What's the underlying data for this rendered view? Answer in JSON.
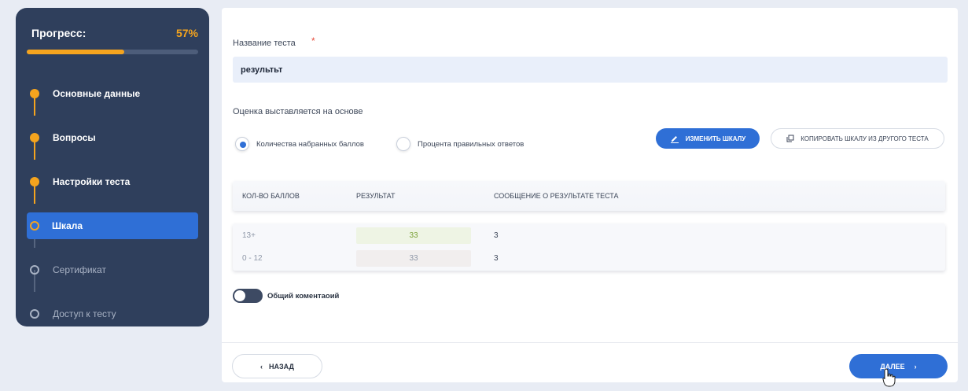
{
  "sidebar": {
    "progress_title": "Прогресс:",
    "progress_percent": "57%",
    "progress_value": 0.57,
    "steps": [
      {
        "label": "Основные данные",
        "state": "done"
      },
      {
        "label": "Вопросы",
        "state": "done"
      },
      {
        "label": "Настройки теста",
        "state": "done"
      },
      {
        "label": "Шкала",
        "state": "current"
      },
      {
        "label": "Сертификат",
        "state": "pending"
      },
      {
        "label": "Доступ к тесту",
        "state": "pending"
      }
    ]
  },
  "form": {
    "name_label": "Название теста",
    "required_mark": "*",
    "name_value": "результьт",
    "basis_label": "Оценка выставляется на основе",
    "radio_points": "Количества набранных баллов",
    "radio_percent": "Процента правильных ответов",
    "edit_scale_button": "Изменить шкалу",
    "copy_scale_button": "Копировать шкалу из другого теста"
  },
  "table": {
    "headers": [
      "Кол-во баллов",
      "Результат",
      "Сообщение о результате теста"
    ],
    "rows": [
      {
        "points": "13+",
        "result": "33",
        "message": "3"
      },
      {
        "points": "0 - 12",
        "result": "33",
        "message": "3"
      }
    ]
  },
  "toggle": {
    "label": "Общий коментаоий"
  },
  "footer": {
    "back_button": "Назад",
    "back_arrow": "‹",
    "next_button": "Далее",
    "next_arrow": "›"
  },
  "colors": {
    "accent": "#2f6fd6",
    "progress": "#f5a41e",
    "sidebar_bg": "#2f3f5c",
    "result_high_bg": "#eef4e4",
    "result_high_text": "#7ea33c",
    "result_low_bg": "#f1eeee",
    "result_low_text": "#8f98a8"
  },
  "icons": {
    "edit_icon": "pencil-icon",
    "copy_icon": "copy-icon"
  }
}
